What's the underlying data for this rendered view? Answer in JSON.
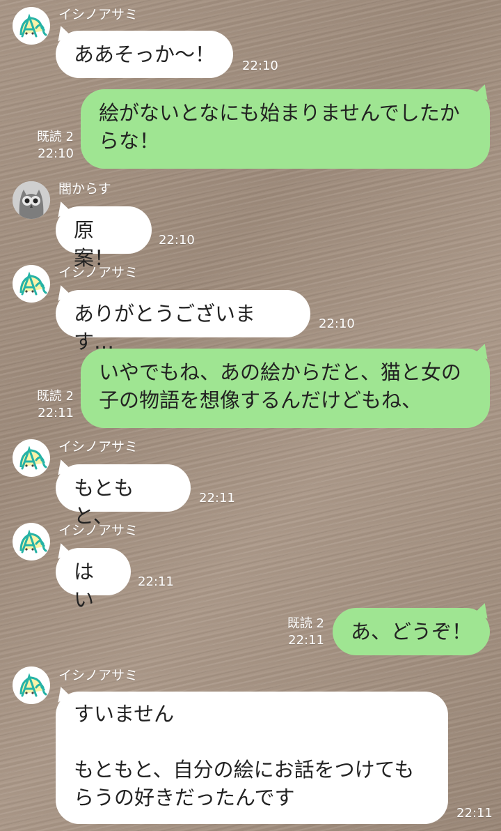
{
  "colors": {
    "incoming_bubble": "#ffffff",
    "outgoing_bubble": "#9fe592",
    "meta_text": "#ffffff",
    "message_text": "#222222"
  },
  "contacts": {
    "ishino": {
      "name": "イシノアサミ",
      "avatar_icon": "ishino-avatar-icon"
    },
    "yami": {
      "name": "闇からす",
      "avatar_icon": "owl-avatar-icon"
    }
  },
  "messages": [
    {
      "direction": "in",
      "sender": "イシノアサミ",
      "text": "ああそっか〜！",
      "time": "22:10"
    },
    {
      "direction": "out",
      "text": "絵がないとなにも始まりませんでしたか\nらな！",
      "read": "既読 2",
      "time": "22:10"
    },
    {
      "direction": "in",
      "sender": "闇からす",
      "text": "原案！",
      "time": "22:10"
    },
    {
      "direction": "in",
      "sender": "イシノアサミ",
      "text": "ありがとうございます…",
      "time": "22:10"
    },
    {
      "direction": "out",
      "text": "いやでもね、あの絵からだと、猫と女の\n子の物語を想像するんだけどもね、",
      "read": "既読 2",
      "time": "22:11"
    },
    {
      "direction": "in",
      "sender": "イシノアサミ",
      "text": "もともと、",
      "time": "22:11"
    },
    {
      "direction": "in",
      "sender": "イシノアサミ",
      "text": "はい",
      "time": "22:11"
    },
    {
      "direction": "out",
      "text": "あ、どうぞ！",
      "read": "既読 2",
      "time": "22:11"
    },
    {
      "direction": "in",
      "sender": "イシノアサミ",
      "text": "すいません\n\nもともと、自分の絵にお話をつけても\nらうの好きだったんです",
      "time": "22:11"
    }
  ]
}
